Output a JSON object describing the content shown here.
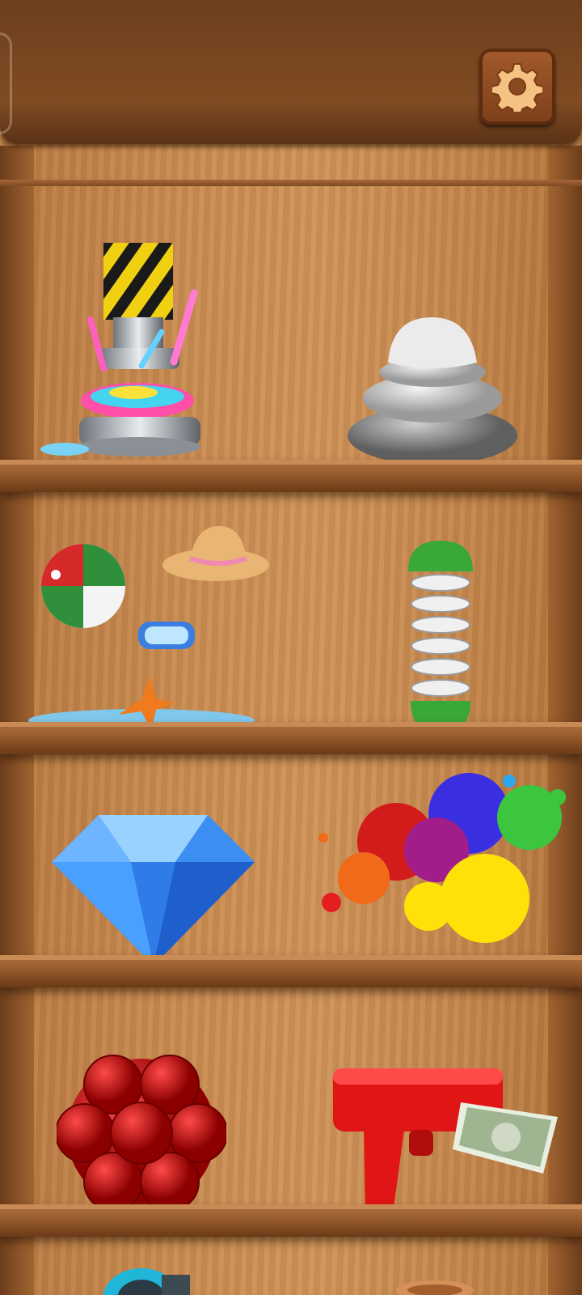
{
  "header": {
    "settings_icon": "gear-icon",
    "settings_color": "#f4c283"
  },
  "shelves": [
    {
      "left_item": {
        "icon": "hydraulic-press-icon"
      },
      "right_item": {
        "icon": "stone-stack-icon"
      }
    },
    {
      "left_item": {
        "icon": "beach-items-icon"
      },
      "right_item": {
        "icon": "spring-toy-icon"
      }
    },
    {
      "left_item": {
        "icon": "diamond-icon"
      },
      "right_item": {
        "icon": "paint-splash-icon"
      }
    },
    {
      "left_item": {
        "icon": "red-ball-icon"
      },
      "right_item": {
        "icon": "money-gun-icon"
      }
    },
    {
      "left_item": {
        "icon": "tape-roll-icon"
      },
      "right_item": {
        "icon": "clay-pot-icon"
      }
    }
  ],
  "colors": {
    "wood_light": "#cf945a",
    "wood_dark": "#6d3f1d",
    "accent": "#e51f1f"
  }
}
